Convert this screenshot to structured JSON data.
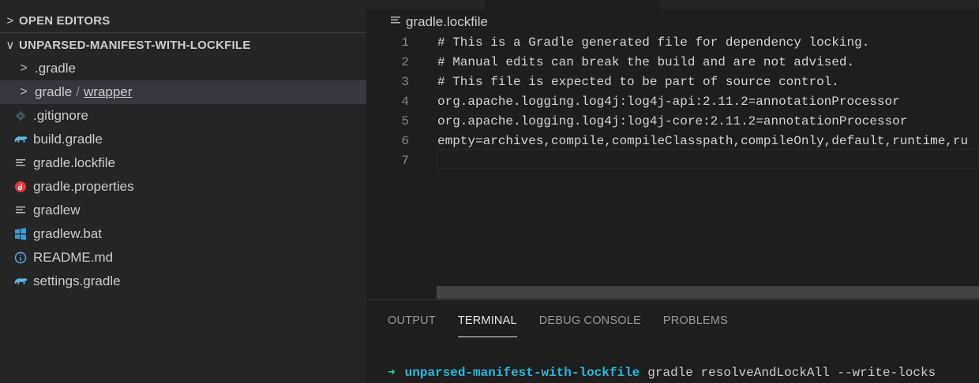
{
  "sidebar": {
    "open_editors": {
      "chevron": ">",
      "label": "OPEN EDITORS"
    },
    "project": {
      "chevron": "∨",
      "label": "UNPARSED-MANIFEST-WITH-LOCKFILE"
    },
    "items": [
      {
        "name": ".gradle",
        "type": "folder",
        "chevron": ">"
      },
      {
        "name": "gradle",
        "sep": "/",
        "sub": "wrapper",
        "type": "folder",
        "chevron": ">"
      },
      {
        "name": ".gitignore",
        "icon": "git-icon"
      },
      {
        "name": "build.gradle",
        "icon": "gradle-elephant-icon"
      },
      {
        "name": "gradle.lockfile",
        "icon": "lines-icon"
      },
      {
        "name": "gradle.properties",
        "icon": "properties-icon"
      },
      {
        "name": "gradlew",
        "icon": "lines-icon"
      },
      {
        "name": "gradlew.bat",
        "icon": "windows-icon"
      },
      {
        "name": "README.md",
        "icon": "info-icon"
      },
      {
        "name": "settings.gradle",
        "icon": "gradle-elephant-icon"
      }
    ]
  },
  "editor": {
    "breadcrumb": "gradle.lockfile",
    "lines": [
      {
        "n": "1",
        "text": "# This is a Gradle generated file for dependency locking."
      },
      {
        "n": "2",
        "text": "# Manual edits can break the build and are not advised."
      },
      {
        "n": "3",
        "text": "# This file is expected to be part of source control."
      },
      {
        "n": "4",
        "text": "org.apache.logging.log4j:log4j-api:2.11.2=annotationProcessor"
      },
      {
        "n": "5",
        "text": "org.apache.logging.log4j:log4j-core:2.11.2=annotationProcessor"
      },
      {
        "n": "6",
        "text": "empty=archives,compile,compileClasspath,compileOnly,default,runtime,ru"
      },
      {
        "n": "7",
        "text": ""
      }
    ]
  },
  "panel": {
    "tabs": [
      "OUTPUT",
      "TERMINAL",
      "DEBUG CONSOLE",
      "PROBLEMS"
    ],
    "active_tab": "TERMINAL",
    "terminal": {
      "arrow": "➜",
      "dir": "unparsed-manifest-with-lockfile",
      "command": "gradle resolveAndLockAll --write-locks"
    }
  },
  "colors": {
    "sidebar_bg": "#252526",
    "editor_bg": "#1e1e1e",
    "selected_row": "#37373d",
    "terminal_arrow": "#23d18b",
    "terminal_dir": "#29b8db"
  }
}
